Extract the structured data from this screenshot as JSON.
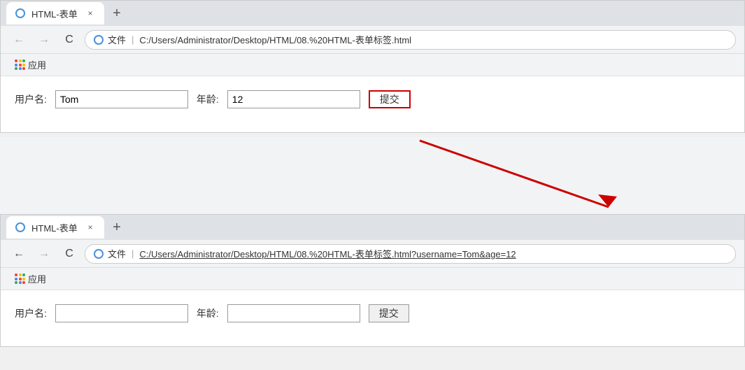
{
  "browser1": {
    "tab": {
      "title": "HTML-表单",
      "close_label": "×",
      "new_tab_label": "+"
    },
    "nav": {
      "back_label": "←",
      "forward_label": "→",
      "reload_label": "C",
      "address_prefix": "文件",
      "address_separator": "|",
      "address_url": "C:/Users/Administrator/Desktop/HTML/08.%20HTML-表单标签.html"
    },
    "bookmarks": {
      "apps_label": "应用"
    },
    "form": {
      "username_label": "用户名:",
      "username_value": "Tom",
      "age_label": "年龄:",
      "age_value": "12",
      "submit_label": "提交"
    }
  },
  "browser2": {
    "tab": {
      "title": "HTML-表单",
      "close_label": "×",
      "new_tab_label": "+"
    },
    "nav": {
      "back_label": "←",
      "forward_label": "→",
      "reload_label": "C",
      "address_prefix": "文件",
      "address_separator": "|",
      "address_url": "C:/Users/Administrator/Desktop/HTML/08.%20HTML-表单标签.html?username=Tom&age=12"
    },
    "bookmarks": {
      "apps_label": "应用"
    },
    "form": {
      "username_label": "用户名:",
      "username_value": "",
      "age_label": "年龄:",
      "age_value": "",
      "submit_label": "提交"
    }
  },
  "apps_dots_colors": [
    "#ea4335",
    "#fbbc05",
    "#34a853",
    "#4285f4",
    "#ea4335",
    "#fbbc05",
    "#34a853",
    "#4285f4",
    "#ea4335"
  ]
}
